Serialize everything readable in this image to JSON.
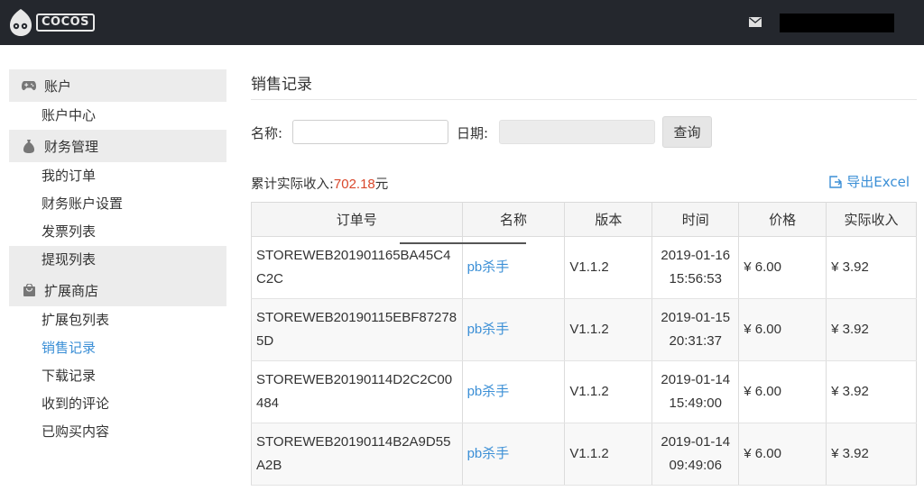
{
  "header": {
    "logo_text": "COCOS",
    "mail_icon": "envelope-icon",
    "user_name_redacted": ""
  },
  "sidebar": {
    "groups": [
      {
        "icon": "gamepad-icon",
        "label": "账户",
        "items": [
          {
            "label": "账户中心"
          }
        ]
      },
      {
        "icon": "money-bag-icon",
        "label": "财务管理",
        "items": [
          {
            "label": "我的订单"
          },
          {
            "label": "财务账户设置"
          },
          {
            "label": "发票列表"
          },
          {
            "label": "提现列表"
          }
        ]
      },
      {
        "icon": "shopping-bag-icon",
        "label": "扩展商店",
        "items": [
          {
            "label": "扩展包列表"
          },
          {
            "label": "销售记录"
          },
          {
            "label": "下载记录"
          },
          {
            "label": "收到的评论"
          },
          {
            "label": "已购买内容"
          }
        ]
      }
    ],
    "active_item": "销售记录"
  },
  "main": {
    "title": "销售记录",
    "search": {
      "name_label": "名称:",
      "name_value": "",
      "date_label": "日期:",
      "date_value": "",
      "query_button": "查询"
    },
    "income": {
      "label": "累计实际收入:",
      "value": "702.18",
      "unit": "元"
    },
    "export_label": "导出Excel",
    "table": {
      "headers": [
        "订单号",
        "名称",
        "版本",
        "时间",
        "价格",
        "实际收入"
      ],
      "rows": [
        {
          "order": "STOREWEB201901165BA45C4C2C",
          "name": "pb杀手",
          "version": "V1.1.2",
          "date": "2019-01-16",
          "time": "15:56:53",
          "price": "¥ 6.00",
          "income": "¥ 3.92"
        },
        {
          "order": "STOREWEB20190115EBF872785D",
          "name": "pb杀手",
          "version": "V1.1.2",
          "date": "2019-01-15",
          "time": "20:31:37",
          "price": "¥ 6.00",
          "income": "¥ 3.92"
        },
        {
          "order": "STOREWEB20190114D2C2C00484",
          "name": "pb杀手",
          "version": "V1.1.2",
          "date": "2019-01-14",
          "time": "15:49:00",
          "price": "¥ 6.00",
          "income": "¥ 3.92"
        },
        {
          "order": "STOREWEB20190114B2A9D55A2B",
          "name": "pb杀手",
          "version": "V1.1.2",
          "date": "2019-01-14",
          "time": "09:49:06",
          "price": "¥ 6.00",
          "income": "¥ 3.92"
        }
      ]
    }
  },
  "colors": {
    "topbar": "#24272d",
    "link": "#3b8fd6",
    "income_value": "#d9472b",
    "sidebar_group_bg": "#ececec"
  }
}
